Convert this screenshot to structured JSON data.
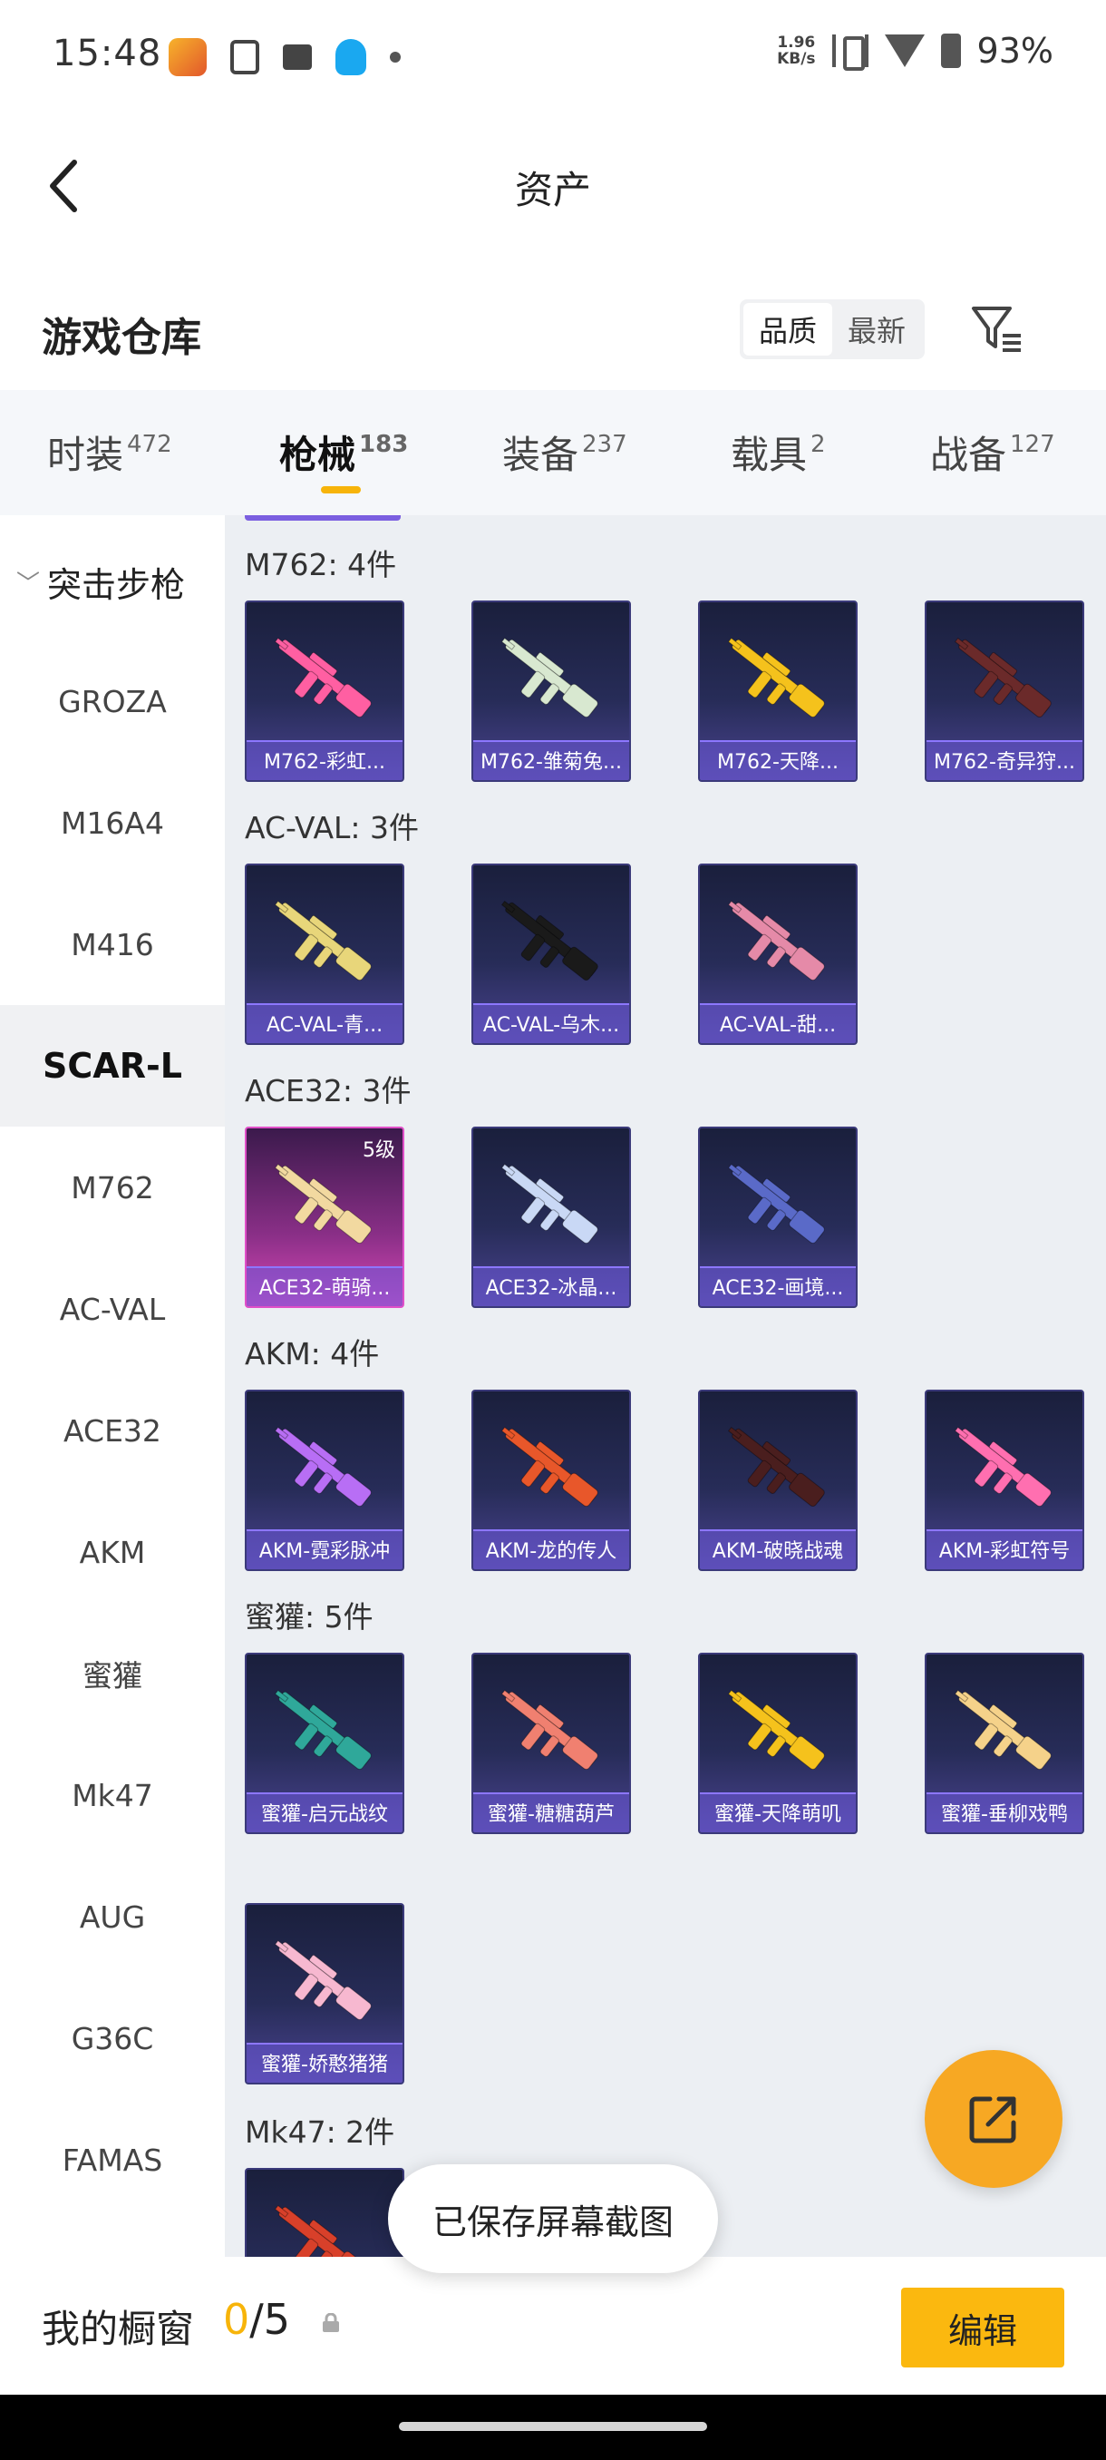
{
  "status_bar": {
    "time": "15:48",
    "net_speed_value": "1.96",
    "net_speed_unit": "KB/s",
    "battery": "93%"
  },
  "header": {
    "title": "资产"
  },
  "warehouse": {
    "title": "游戏仓库",
    "sort_options": [
      "品质",
      "最新"
    ],
    "active_sort": "品质"
  },
  "tabs": [
    {
      "label": "时装",
      "count": "472"
    },
    {
      "label": "枪械",
      "count": "183",
      "active": true
    },
    {
      "label": "装备",
      "count": "237"
    },
    {
      "label": "载具",
      "count": "2"
    },
    {
      "label": "战备",
      "count": "127"
    }
  ],
  "sidebar": {
    "group": "突击步枪",
    "items": [
      "GROZA",
      "M16A4",
      "M416",
      "SCAR-L",
      "M762",
      "AC-VAL",
      "ACE32",
      "AKM",
      "蜜獾",
      "Mk47",
      "AUG",
      "G36C",
      "FAMAS"
    ],
    "active": "SCAR-L"
  },
  "groups": [
    {
      "label": "M762: 4件",
      "items": [
        "M762-彩虹...",
        "M762-雏菊兔...",
        "M762-天降...",
        "M762-奇异狩..."
      ]
    },
    {
      "label": "AC-VAL: 3件",
      "items": [
        "AC-VAL-青...",
        "AC-VAL-乌木...",
        "AC-VAL-甜..."
      ]
    },
    {
      "label": "ACE32: 3件",
      "items": [
        "ACE32-萌骑...",
        "ACE32-冰晶...",
        "ACE32-画境..."
      ],
      "first_level": "5级"
    },
    {
      "label": "AKM: 4件",
      "items": [
        "AKM-霓彩脉冲",
        "AKM-龙的传人",
        "AKM-破晓战魂",
        "AKM-彩虹符号"
      ]
    },
    {
      "label": "蜜獾: 5件",
      "items": [
        "蜜獾-启元战纹",
        "蜜獾-糖糖葫芦",
        "蜜獾-天降萌叽",
        "蜜獾-垂柳戏鸭",
        "蜜獾-娇憨猪猪"
      ]
    },
    {
      "label": "Mk47: 2件",
      "items": []
    }
  ],
  "toast": "已保存屏幕截图",
  "showcase": {
    "label": "我的橱窗",
    "current": "0",
    "total": "/5",
    "edit_label": "编辑"
  },
  "colors": {
    "accent": "#f7b40a",
    "card_purple": "#4a4390",
    "card_pink": "#d848b6",
    "fab": "#f7a823"
  }
}
